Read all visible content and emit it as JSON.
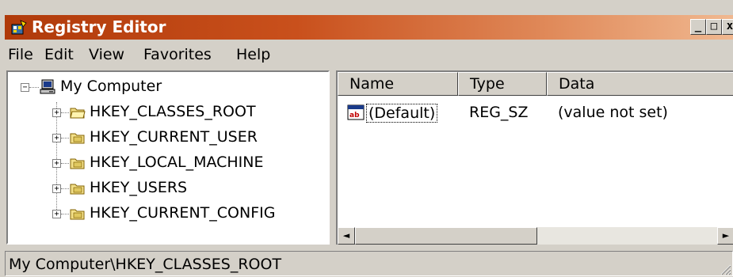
{
  "window": {
    "title": "Registry Editor"
  },
  "titlebar": {
    "minimize": "_",
    "maximize": "□",
    "close": "x"
  },
  "menu": {
    "items": [
      "File",
      "Edit",
      "View",
      "Favorites",
      "Help"
    ]
  },
  "tree": {
    "root": "My Computer",
    "root_expander": "−",
    "children": [
      {
        "label": "HKEY_CLASSES_ROOT",
        "expander": "+"
      },
      {
        "label": "HKEY_CURRENT_USER",
        "expander": "+"
      },
      {
        "label": "HKEY_LOCAL_MACHINE",
        "expander": "+"
      },
      {
        "label": "HKEY_USERS",
        "expander": "+"
      },
      {
        "label": "HKEY_CURRENT_CONFIG",
        "expander": "+"
      }
    ]
  },
  "list": {
    "columns": [
      "Name",
      "Type",
      "Data"
    ],
    "rows": [
      {
        "name": "(Default)",
        "type": "REG_SZ",
        "data": "(value not set)",
        "icon": "string-value-icon"
      }
    ]
  },
  "scroll": {
    "left_arrow": "◄",
    "right_arrow": "►"
  },
  "status": {
    "path": "My Computer\\HKEY_CLASSES_ROOT"
  },
  "colors": {
    "title_gradient_start": "#b03a0a",
    "title_gradient_end": "#f0b890",
    "face": "#d4d0c8"
  }
}
